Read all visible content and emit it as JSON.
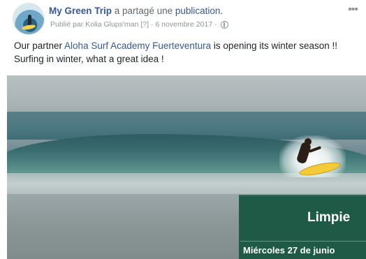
{
  "header": {
    "page_name": "My Green Trip",
    "action_text": " a partagé une ",
    "publication_link": "publication.",
    "meta_prefix": "Publié par Kolia Glups'man",
    "meta_badge": "[?]",
    "meta_date": "· 6 novembre 2017 ·",
    "more_label": "•••"
  },
  "post": {
    "text_before_link": "Our partner ",
    "partner_link": "Aloha Surf Academy Fuerteventura",
    "text_after_link": " is opening its winter season !! Surfing in winter, what a great idea !"
  },
  "image_overlay": {
    "title": "Limpie",
    "date": "Miércoles 27 de junio"
  }
}
